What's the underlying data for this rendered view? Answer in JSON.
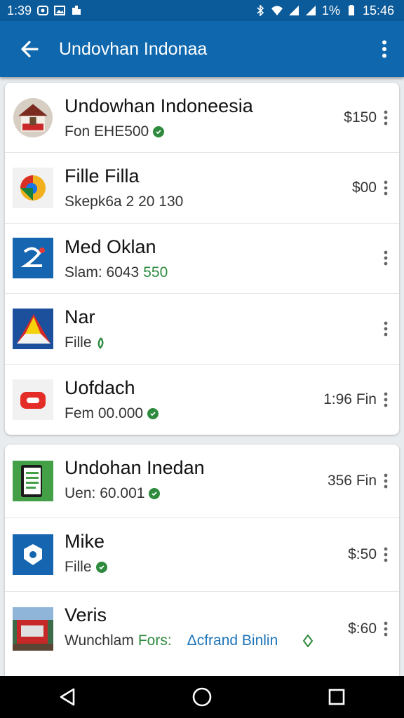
{
  "status_bar": {
    "left_time": "1:39",
    "battery": "1%",
    "time": "15:46"
  },
  "app_bar": {
    "title": "Undovhan Indonaa"
  },
  "card1": [
    {
      "title": "Undowhan Indoneesia",
      "subtitle": "Fon EHE500",
      "price": "$150",
      "icon": "house-photo-icon"
    },
    {
      "title": "Fille Filla",
      "subtitle": "Skepk6a 2 20 130",
      "price": "$00",
      "icon": "browser-app-icon"
    },
    {
      "title": "Med Oklan",
      "subtitle": "Slam: 6043",
      "subtitle_extra": "550",
      "price": "",
      "icon": "blue-app-icon"
    },
    {
      "title": "Nar",
      "subtitle": "Fille",
      "price": "",
      "icon": "triangle-flag-icon"
    },
    {
      "title": "Uofdach",
      "subtitle": "Fem 00.000",
      "price": "1:96 Fin",
      "icon": "video-app-icon"
    }
  ],
  "card2": [
    {
      "title": "Undohan Inedan",
      "subtitle": "Uen: 60.001",
      "price": "356 Fin",
      "icon": "document-app-icon"
    },
    {
      "title": "Mike",
      "subtitle": "Fille",
      "price": "$:50",
      "icon": "shield-app-icon"
    },
    {
      "title": "Veris",
      "subtitle": "Wunchlam",
      "subtitle_extra": "Fors:",
      "subtitle_extra2": "Δcfrand Binlin",
      "price": "$:60",
      "icon": "market-photo-icon"
    }
  ],
  "colors": {
    "app_bar": "#0f67ad",
    "status_bar": "#0b5a99",
    "accent_green": "#2e8b3e"
  }
}
